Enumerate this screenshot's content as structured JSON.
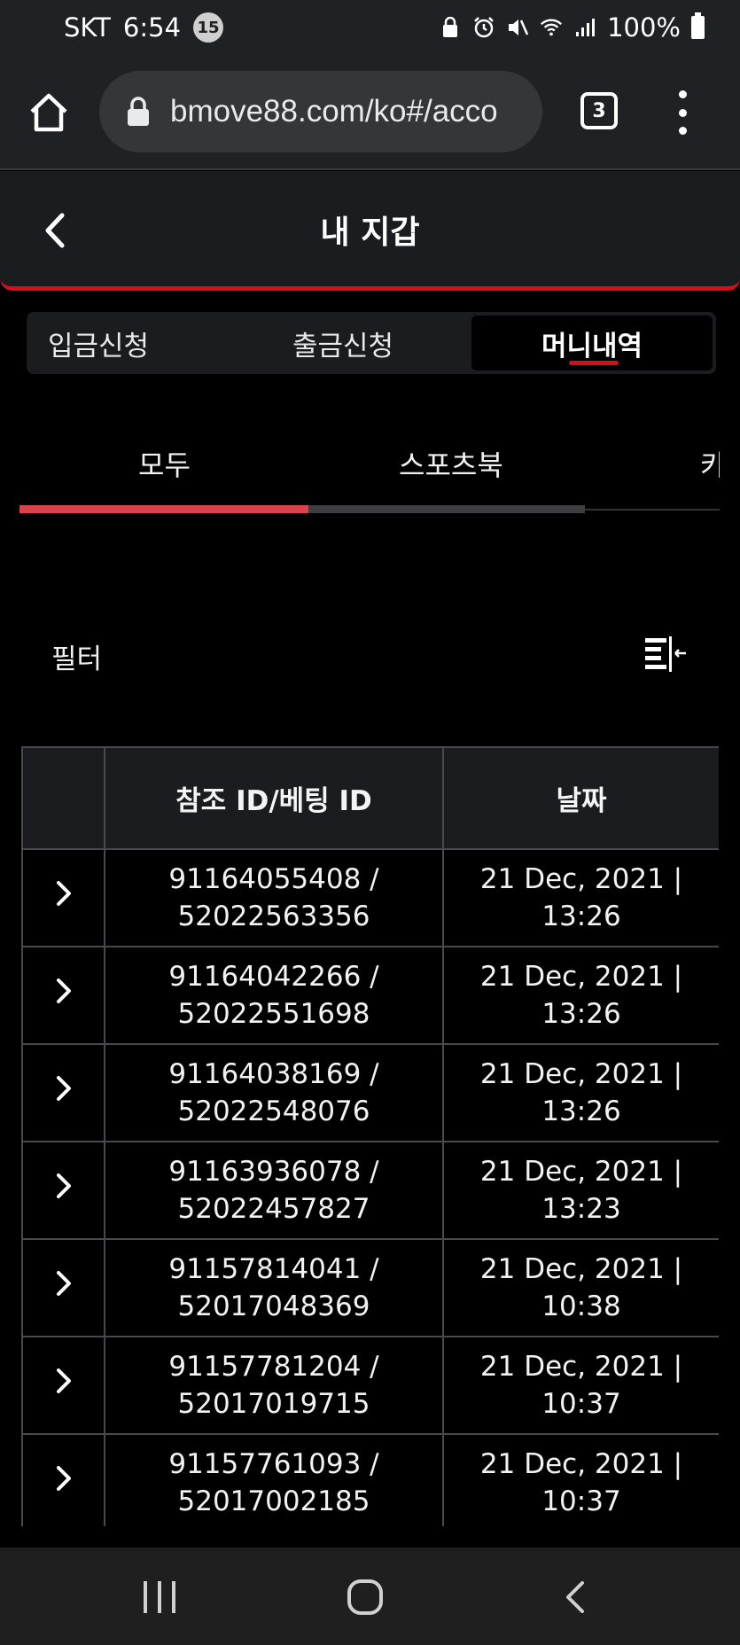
{
  "status_bar": {
    "carrier": "SKT",
    "time": "6:54",
    "notification_count": "15",
    "battery": "100%"
  },
  "browser": {
    "url": "bmove88.com/ko#/acco",
    "tab_count": "3"
  },
  "header": {
    "title": "내 지갑"
  },
  "wallet_tabs": [
    {
      "label": "입금신청"
    },
    {
      "label": "출금신청"
    },
    {
      "label": "머니내역",
      "active": true
    }
  ],
  "category_tabs": [
    {
      "label": "모두",
      "active": true
    },
    {
      "label": "스포츠북"
    },
    {
      "label": "카"
    }
  ],
  "filter": {
    "label": "필터"
  },
  "table": {
    "headers": [
      "",
      "참조 ID/베팅 ID",
      "날짜"
    ],
    "rows": [
      {
        "ref": "91164055408 /",
        "bet": "52022563356",
        "date": "21 Dec, 2021 |",
        "time": "13:26"
      },
      {
        "ref": "91164042266 /",
        "bet": "52022551698",
        "date": "21 Dec, 2021 |",
        "time": "13:26"
      },
      {
        "ref": "91164038169 /",
        "bet": "52022548076",
        "date": "21 Dec, 2021 |",
        "time": "13:26"
      },
      {
        "ref": "91163936078 /",
        "bet": "52022457827",
        "date": "21 Dec, 2021 |",
        "time": "13:23"
      },
      {
        "ref": "91157814041 /",
        "bet": "52017048369",
        "date": "21 Dec, 2021 |",
        "time": "10:38"
      },
      {
        "ref": "91157781204 /",
        "bet": "52017019715",
        "date": "21 Dec, 2021 |",
        "time": "10:37"
      },
      {
        "ref": "91157761093 /",
        "bet": "52017002185",
        "date": "21 Dec, 2021 |",
        "time": "10:37"
      }
    ]
  },
  "colors": {
    "accent_red": "#d40f1a",
    "scroll_red": "#d9434b",
    "panel_bg": "#1b1c20",
    "page_bg": "#000000"
  },
  "icons": {
    "home": "home-icon",
    "lock": "lock-icon",
    "menu": "more-vert-icon",
    "back": "chevron-left-icon",
    "filter": "filter-collapse-icon",
    "row_expand": "chevron-right-icon"
  }
}
